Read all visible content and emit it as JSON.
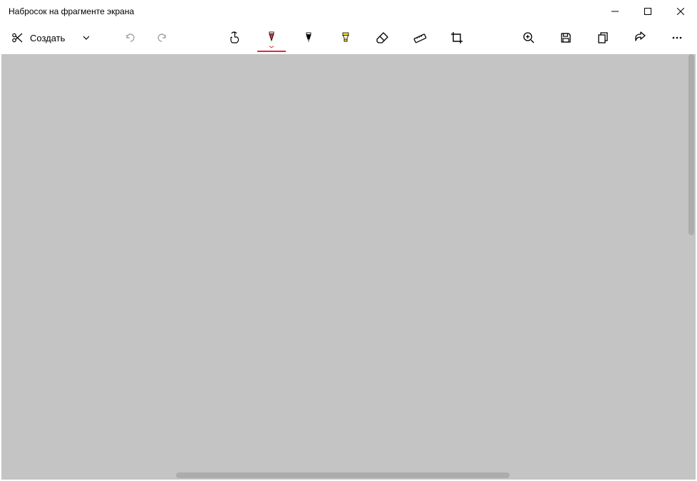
{
  "window": {
    "title": "Набросок на фрагменте экрана"
  },
  "toolbar": {
    "new_label": "Создать"
  },
  "tools": {
    "touch_writing": "touch-writing",
    "ballpoint_pen": "ballpoint-pen",
    "pencil": "pencil",
    "highlighter": "highlighter",
    "eraser": "eraser",
    "ruler": "ruler",
    "crop": "crop",
    "zoom": "zoom",
    "save": "save",
    "copy": "copy",
    "share": "share",
    "more": "more"
  },
  "colors": {
    "pen_red": "#d13438",
    "pencil_black": "#000000",
    "highlighter_yellow": "#ffe600"
  }
}
